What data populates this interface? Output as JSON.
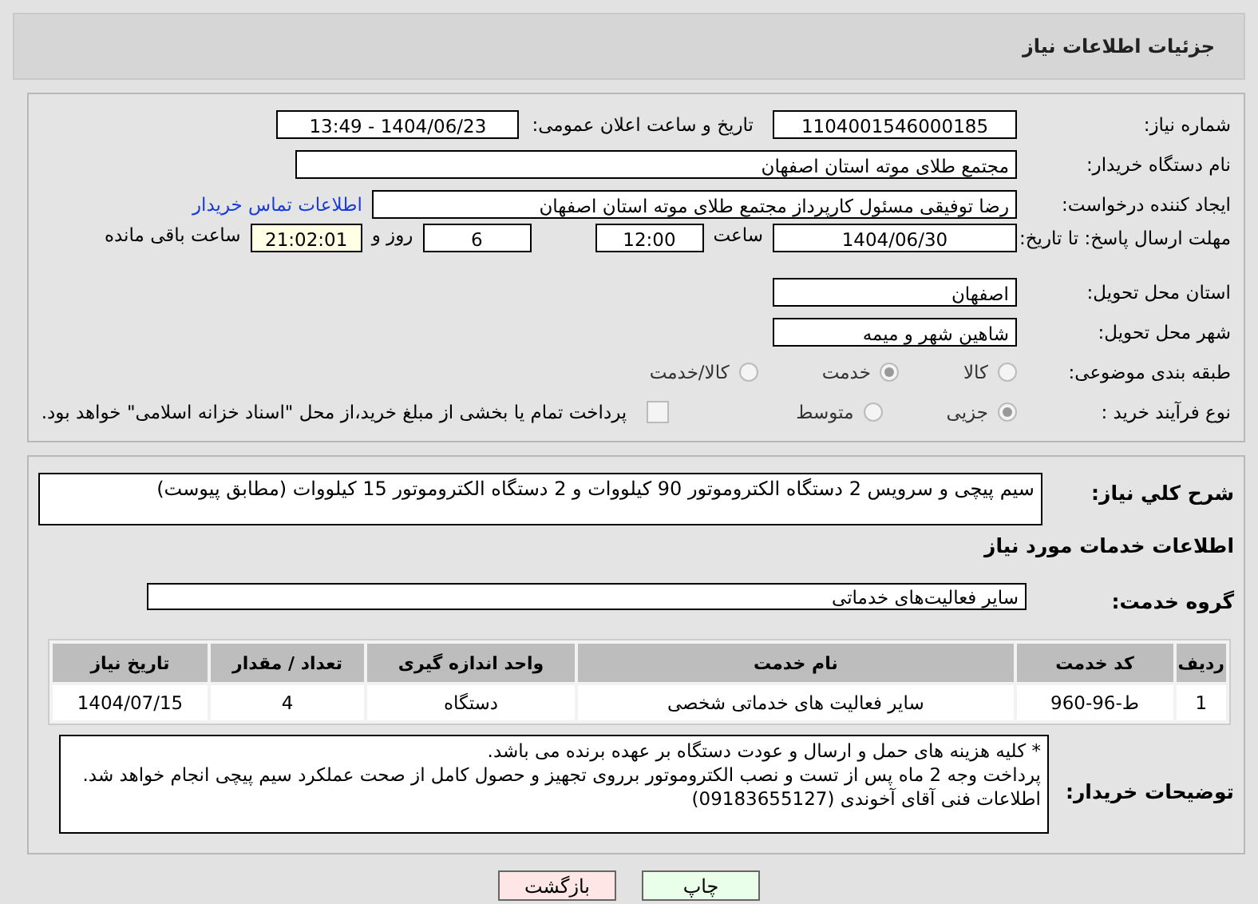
{
  "header": {
    "title": "جزئیات اطلاعات نیاز"
  },
  "info": {
    "need_number": {
      "label": "شماره نیاز:",
      "value": "1104001546000185"
    },
    "announce": {
      "label": "تاریخ و ساعت اعلان عمومی:",
      "value": "1404/06/23 - 13:49"
    },
    "buyer": {
      "label": "نام دستگاه خریدار:",
      "value": "مجتمع طلای موته استان اصفهان"
    },
    "creator": {
      "label": "ایجاد کننده درخواست:",
      "value": "رضا توفیقی مسئول کارپرداز مجتمع طلای موته استان اصفهان",
      "link": "اطلاعات تماس خریدار"
    },
    "deadline": {
      "label": "مهلت ارسال پاسخ: تا تاریخ:",
      "date": "1404/06/30",
      "time_label": "ساعت",
      "time": "12:00",
      "days": "6",
      "days_label": "روز و",
      "remaining": "21:02:01",
      "remaining_label": "ساعت باقی مانده"
    },
    "province": {
      "label": "استان محل تحویل:",
      "value": "اصفهان"
    },
    "city": {
      "label": "شهر محل تحویل:",
      "value": "شاهین شهر و میمه"
    },
    "category": {
      "label": "طبقه بندی موضوعی:",
      "options": [
        {
          "label": "کالا",
          "selected": false
        },
        {
          "label": "خدمت",
          "selected": true
        },
        {
          "label": "کالا/خدمت",
          "selected": false
        }
      ]
    },
    "process": {
      "label": "نوع فرآیند خرید :",
      "options": [
        {
          "label": "جزیی",
          "selected": true
        },
        {
          "label": "متوسط",
          "selected": false
        }
      ],
      "treasury": {
        "checked": false,
        "text": "پرداخت تمام یا بخشی از مبلغ خرید،از محل \"اسناد خزانه اسلامی\" خواهد بود."
      }
    }
  },
  "details": {
    "summary": {
      "label": "شرح کلي نياز:",
      "value": "سیم پیچی و سرویس 2 دستگاه الکتروموتور 90 کیلووات و 2 دستگاه الکتروموتور 15 کیلووات (مطابق پیوست)"
    },
    "services_heading": "اطلاعات خدمات مورد نیاز",
    "group": {
      "label": "گروه خدمت:",
      "value": "سایر فعالیت‌های خدماتی"
    },
    "table": {
      "columns": [
        "ردیف",
        "کد خدمت",
        "نام خدمت",
        "واحد اندازه گیری",
        "تعداد / مقدار",
        "تاریخ نیاز"
      ],
      "rows": [
        [
          "1",
          "ط-96-960",
          "سایر فعالیت های خدماتی شخصی",
          "دستگاه",
          "4",
          "1404/07/15"
        ]
      ]
    },
    "notes": {
      "label": "توضیحات خریدار:",
      "lines": [
        "* کلیه هزینه های حمل و ارسال و عودت دستگاه بر عهده برنده می باشد.",
        "پرداخت وجه 2 ماه پس از تست و نصب الکتروموتور برروی تجهیز و حصول کامل از صحت عملکرد سیم پیچی انجام خواهد شد.",
        "اطلاعات فنی آقای آخوندی (09183655127)"
      ]
    }
  },
  "buttons": [
    {
      "label": "چاپ",
      "kind": "print"
    },
    {
      "label": "بازگشت",
      "kind": "back"
    }
  ]
}
